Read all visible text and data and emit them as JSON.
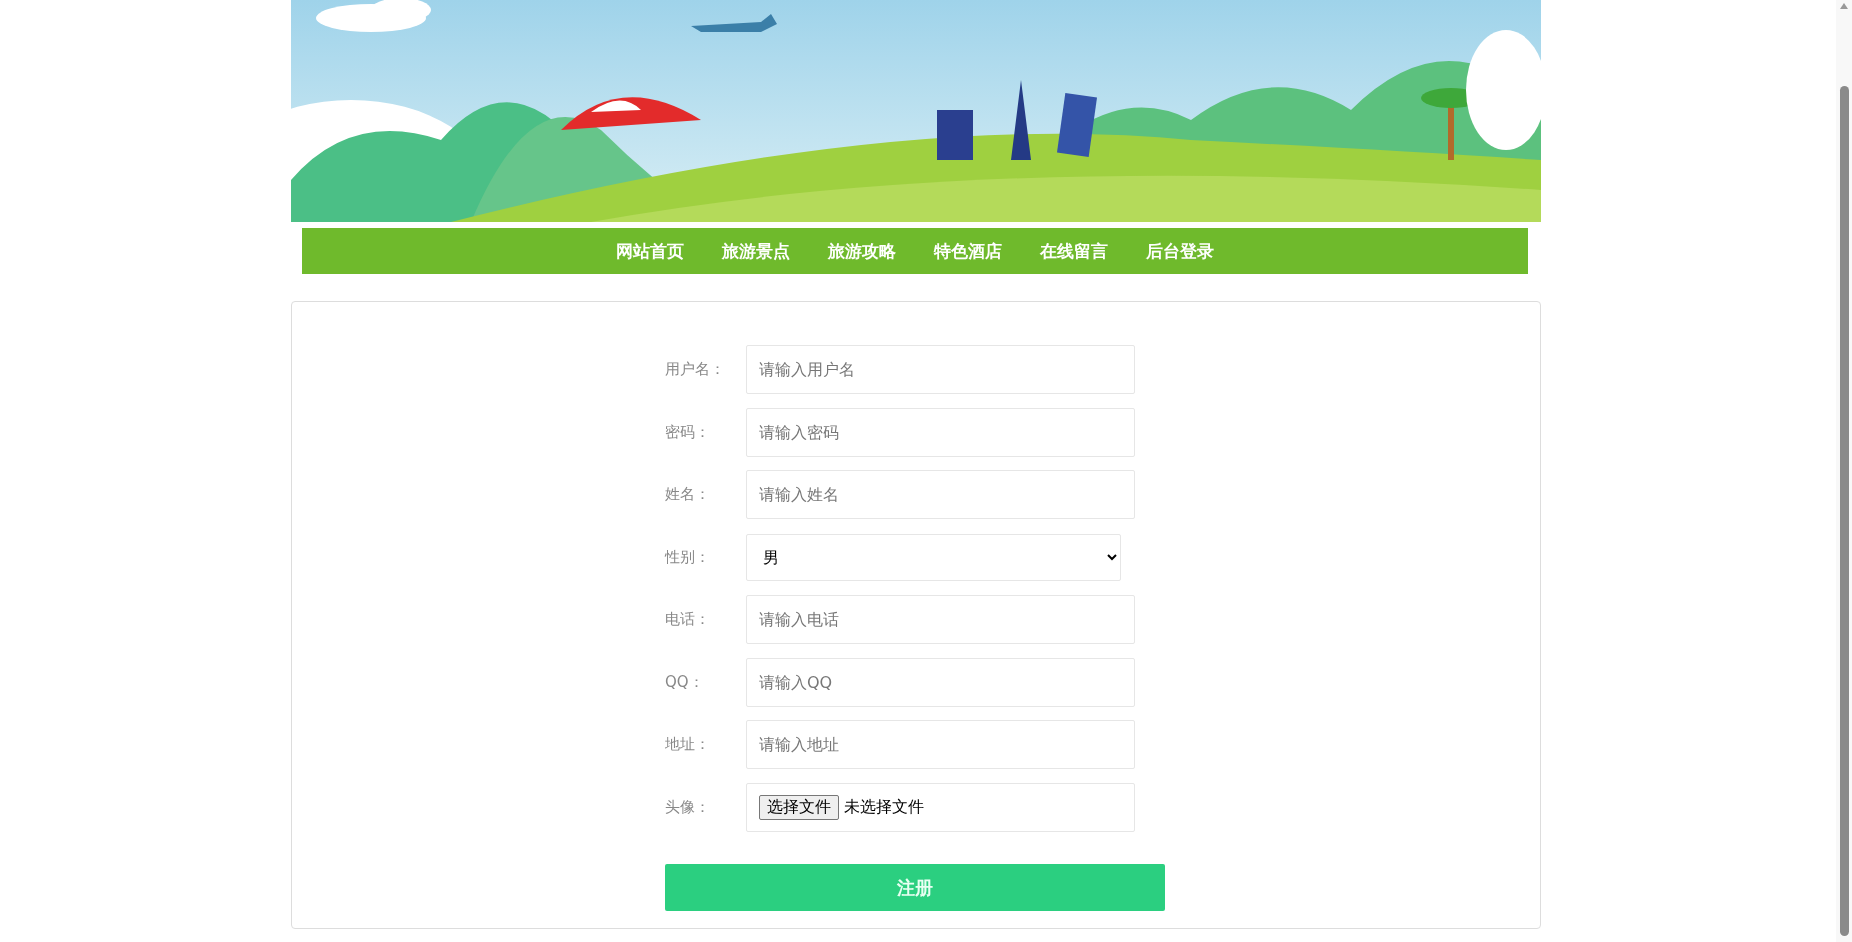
{
  "nav": {
    "items": [
      {
        "label": "网站首页"
      },
      {
        "label": "旅游景点"
      },
      {
        "label": "旅游攻略"
      },
      {
        "label": "特色酒店"
      },
      {
        "label": "在线留言"
      },
      {
        "label": "后台登录"
      }
    ]
  },
  "form": {
    "fields": [
      {
        "kind": "text",
        "label": "用户名：",
        "placeholder": "请输入用户名"
      },
      {
        "kind": "text",
        "label": "密码：",
        "placeholder": "请输入密码"
      },
      {
        "kind": "text",
        "label": "姓名：",
        "placeholder": "请输入姓名"
      },
      {
        "kind": "select",
        "label": "性别：",
        "value": "男"
      },
      {
        "kind": "text",
        "label": "电话：",
        "placeholder": "请输入电话"
      },
      {
        "kind": "text",
        "label": "QQ：",
        "placeholder": "请输入QQ"
      },
      {
        "kind": "text",
        "label": "地址：",
        "placeholder": "请输入地址"
      },
      {
        "kind": "file",
        "label": "头像：",
        "button": "选择文件",
        "status": "未选择文件"
      }
    ],
    "submit": "注册"
  }
}
